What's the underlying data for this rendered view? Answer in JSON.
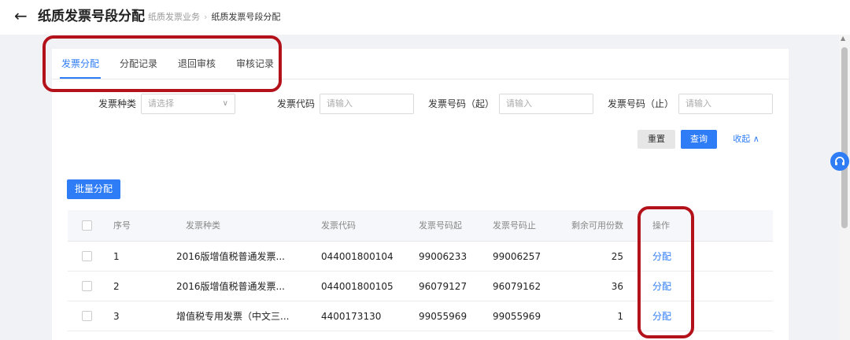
{
  "header": {
    "back_icon": "arrow-left-icon",
    "title": "纸质发票号段分配",
    "breadcrumb": [
      "纸质发票业务",
      "纸质发票号段分配"
    ],
    "breadcrumb_separator": "›"
  },
  "tabs": [
    {
      "label": "发票分配",
      "active": true
    },
    {
      "label": "分配记录",
      "active": false
    },
    {
      "label": "退回审核",
      "active": false
    },
    {
      "label": "审核记录",
      "active": false
    }
  ],
  "filters": {
    "invoice_type": {
      "label": "发票种类",
      "placeholder": "请选择"
    },
    "invoice_code": {
      "label": "发票代码",
      "placeholder": "请输入"
    },
    "number_start": {
      "label": "发票号码（起）",
      "placeholder": "请输入"
    },
    "number_end": {
      "label": "发票号码（止）",
      "placeholder": "请输入"
    }
  },
  "actions": {
    "reset": "重置",
    "query": "查询",
    "collapse": "收起 ∧",
    "batch_allocate": "批量分配"
  },
  "table": {
    "headers": [
      "序号",
      "发票种类",
      "发票代码",
      "发票号码起",
      "发票号码止",
      "剩余可用份数",
      "操作"
    ],
    "rows": [
      {
        "index": "1",
        "type": "2016版增值税普通发票...",
        "code": "044001800104",
        "start": "99006233",
        "end": "99006257",
        "remaining": "25",
        "action": "分配"
      },
      {
        "index": "2",
        "type": "2016版增值税普通发票...",
        "code": "044001800105",
        "start": "96079127",
        "end": "96079162",
        "remaining": "36",
        "action": "分配"
      },
      {
        "index": "3",
        "type": "增值税专用发票（中文三...",
        "code": "4400173130",
        "start": "99055969",
        "end": "99055969",
        "remaining": "1",
        "action": "分配"
      }
    ]
  },
  "colors": {
    "accent": "#2f7df6",
    "highlight": "#b3121b",
    "page_background": "#f0f2f5"
  }
}
